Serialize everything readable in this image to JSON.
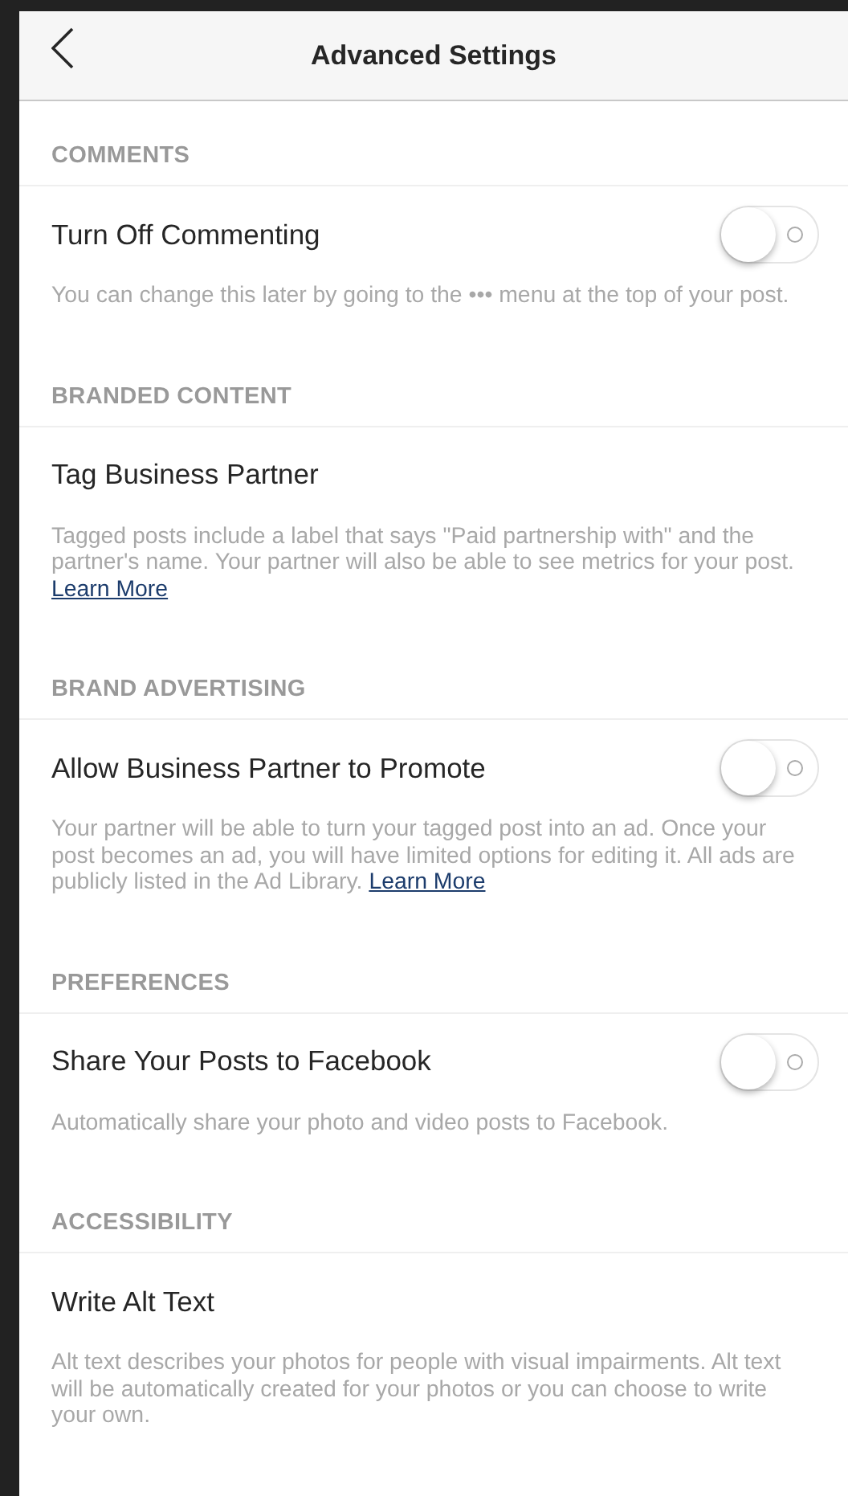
{
  "header": {
    "title": "Advanced Settings"
  },
  "sections": [
    {
      "heading": "COMMENTS",
      "item": {
        "kind": "toggle",
        "label": "Turn Off Commenting",
        "on": false
      },
      "description": "You can change this later by going to the ••• menu at the top of your post."
    },
    {
      "heading": "BRANDED CONTENT",
      "item": {
        "kind": "plain",
        "label": "Tag Business Partner"
      },
      "description": "Tagged posts include a label that says \"Paid partnership with\" and the partner's name. Your partner will also be able to see metrics for your post.",
      "link": "Learn More"
    },
    {
      "heading": "BRAND ADVERTISING",
      "item": {
        "kind": "toggle",
        "label": "Allow Business Partner to Promote",
        "on": false
      },
      "description": "Your partner will be able to turn your tagged post into an ad. Once your post becomes an ad, you will have limited options for editing it. All ads are publicly listed in the Ad Library.",
      "link": "Learn More"
    },
    {
      "heading": "PREFERENCES",
      "item": {
        "kind": "toggle",
        "label": "Share Your Posts to Facebook",
        "on": false
      },
      "description": "Automatically share your photo and video posts to Facebook."
    },
    {
      "heading": "ACCESSIBILITY",
      "item": {
        "kind": "plain",
        "label": "Write Alt Text"
      },
      "description": "Alt text describes your photos for people with visual impairments. Alt text will be automatically created for your photos or you can choose to write your own."
    }
  ]
}
